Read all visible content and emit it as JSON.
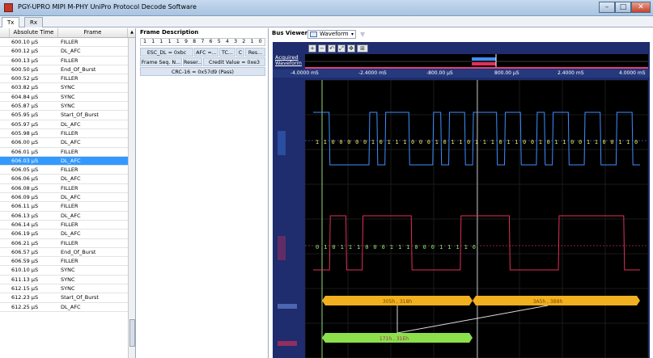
{
  "window": {
    "title": "PGY-UPRO MIPI M-PHY UniPro Protocol Decode Software",
    "buttons": {
      "minimize": "–",
      "maximize": "□",
      "close": "✕"
    }
  },
  "tabs": [
    {
      "label": "Tx",
      "active": true
    },
    {
      "label": "Rx",
      "active": false
    }
  ],
  "packet_list": {
    "columns": [
      "Absolute Time",
      "Frame"
    ],
    "selected_index": 13,
    "rows": [
      {
        "time": "600.10 µS",
        "frame": "FILLER"
      },
      {
        "time": "600.12 µS",
        "frame": "DL_AFC"
      },
      {
        "time": "600.13 µS",
        "frame": "FILLER"
      },
      {
        "time": "600.50 µS",
        "frame": "End_Of_Burst"
      },
      {
        "time": "600.52 µS",
        "frame": "FILLER"
      },
      {
        "time": "603.82 µS",
        "frame": "SYNC"
      },
      {
        "time": "604.84 µS",
        "frame": "SYNC"
      },
      {
        "time": "605.87 µS",
        "frame": "SYNC"
      },
      {
        "time": "605.95 µS",
        "frame": "Start_Of_Burst"
      },
      {
        "time": "605.97 µS",
        "frame": "DL_AFC"
      },
      {
        "time": "605.98 µS",
        "frame": "FILLER"
      },
      {
        "time": "606.00 µS",
        "frame": "DL_AFC"
      },
      {
        "time": "606.01 µS",
        "frame": "FILLER"
      },
      {
        "time": "606.03 µS",
        "frame": "DL_AFC"
      },
      {
        "time": "606.05 µS",
        "frame": "FILLER"
      },
      {
        "time": "606.06 µS",
        "frame": "DL_AFC"
      },
      {
        "time": "606.08 µS",
        "frame": "FILLER"
      },
      {
        "time": "606.09 µS",
        "frame": "DL_AFC"
      },
      {
        "time": "606.11 µS",
        "frame": "FILLER"
      },
      {
        "time": "606.13 µS",
        "frame": "DL_AFC"
      },
      {
        "time": "606.14 µS",
        "frame": "FILLER"
      },
      {
        "time": "606.19 µS",
        "frame": "DL_AFC"
      },
      {
        "time": "606.21 µS",
        "frame": "FILLER"
      },
      {
        "time": "606.57 µS",
        "frame": "End_Of_Burst"
      },
      {
        "time": "606.59 µS",
        "frame": "FILLER"
      },
      {
        "time": "610.10 µS",
        "frame": "SYNC"
      },
      {
        "time": "611.13 µS",
        "frame": "SYNC"
      },
      {
        "time": "612.15 µS",
        "frame": "SYNC"
      },
      {
        "time": "612.23 µS",
        "frame": "Start_Of_Burst"
      },
      {
        "time": "612.25 µS",
        "frame": "DL_AFC"
      }
    ]
  },
  "frame_description": {
    "title": "Frame Description",
    "bit_header": [
      "1",
      "1",
      "1",
      "1",
      "1",
      "9",
      "8",
      "7",
      "6",
      "5",
      "4",
      "3",
      "2",
      "1",
      "0"
    ],
    "row1": {
      "esc": "ESC_DL = 0xbc",
      "afc": "AFC =...",
      "tc": "TC...",
      "c": "C",
      "res": "Res..."
    },
    "row2": {
      "seq": "Frame Seq. N...",
      "reser": "Reser...",
      "credit": "Credit Value = 0xe3"
    },
    "row3": {
      "crc": "CRC-16 = 0x57d9 (Pass)"
    }
  },
  "bus_viewer": {
    "title": "Bus Viewer",
    "view_select": "Waveform",
    "acquired_label": "Acquired Waveform",
    "time_labels": [
      "-4.0000 mS",
      "-2.4000 mS",
      "-800.00 µS",
      "800.00 µS",
      "2.4000 mS",
      "4.0000 mS"
    ],
    "channel1_bits": [
      "1",
      "1",
      "0",
      "0",
      "0",
      "0",
      "0",
      "1",
      "0",
      "1",
      "1",
      "1",
      "0",
      "0",
      "0",
      "1",
      "0",
      "1",
      "1",
      "0",
      "1",
      "1",
      "1",
      "0",
      "1",
      "1",
      "0",
      "0",
      "1",
      "0",
      "1",
      "1",
      "0",
      "0",
      "1",
      "1",
      "0",
      "0",
      "1",
      "1",
      "0"
    ],
    "channel2_bits": [
      "0",
      "1",
      "0",
      "1",
      "1",
      "1",
      "0",
      "0",
      "0",
      "1",
      "1",
      "1",
      "0",
      "0",
      "0",
      "1",
      "1",
      "1",
      "1",
      "0"
    ],
    "bus1": {
      "label1": "305h , 318h",
      "label2": "3A5h , 3B8h"
    },
    "bus2": {
      "label": "171h , 31Eh"
    },
    "colors": {
      "ch1": "#3f8fff",
      "ch2": "#e0305a",
      "bits1": "#f0e060",
      "bits2": "#7cf07c",
      "bus1": "#f0b020",
      "bus2": "#8ce04c"
    }
  }
}
